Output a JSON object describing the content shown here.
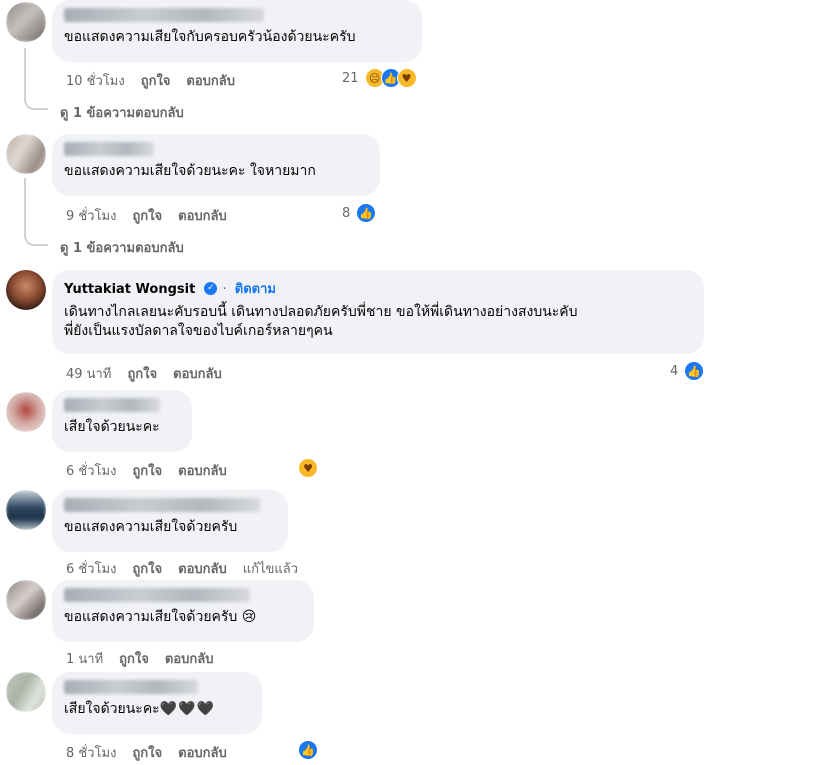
{
  "comments": [
    {
      "text": "ขอแสดงความเสียใจกับครอบครัวน้องด้วยนะครับ",
      "time": "10 ชั่วโมง",
      "like": "ถูกใจ",
      "reply": "ตอบกลับ",
      "reaction_count": "21",
      "replies_link": "ดู 1 ข้อความตอบกลับ"
    },
    {
      "text": "ขอแสดงความเสียใจด้วยนะคะ ใจหายมาก",
      "time": "9 ชั่วโมง",
      "like": "ถูกใจ",
      "reply": "ตอบกลับ",
      "reaction_count": "8",
      "replies_link": "ดู 1 ข้อความตอบกลับ"
    },
    {
      "name": "Yuttakiat Wongsit",
      "follow": "ติดตาม",
      "text_line1": "เดินทางไกลเลยนะคับรอบนี้ เดินทางปลอดภัยครับพี่ชาย ขอให้พี่เดินทางอย่างสงบนะคับ",
      "text_line2": "พี่ยังเป็นแรงบัลดาลใจของไบค์เกอร์หลายๆคน",
      "time": "49 นาที",
      "like": "ถูกใจ",
      "reply": "ตอบกลับ",
      "reaction_count": "4"
    },
    {
      "text": "เสียใจด้วยนะคะ",
      "time": "6 ชั่วโมง",
      "like": "ถูกใจ",
      "reply": "ตอบกลับ"
    },
    {
      "text": "ขอแสดงความเสียใจด้วยครับ",
      "time": "6 ชั่วโมง",
      "like": "ถูกใจ",
      "reply": "ตอบกลับ",
      "edited": "แก้ไขแล้ว"
    },
    {
      "text": "ขอแสดงความเสียใจด้วยครับ",
      "emoji": "😢",
      "time": "1 นาที",
      "like": "ถูกใจ",
      "reply": "ตอบกลับ"
    },
    {
      "text": "เสียใจด้วยนะคะ",
      "emoji": "🖤🖤🖤",
      "time": "8 ชั่วโมง",
      "like": "ถูกใจ",
      "reply": "ตอบกลับ"
    }
  ],
  "colors": {
    "link": "#1877f2",
    "meta": "#65676b",
    "bubble": "#f0f2f5"
  },
  "icons": [
    "like-reaction-icon",
    "care-reaction-icon",
    "sad-reaction-icon",
    "verified-badge-icon"
  ]
}
